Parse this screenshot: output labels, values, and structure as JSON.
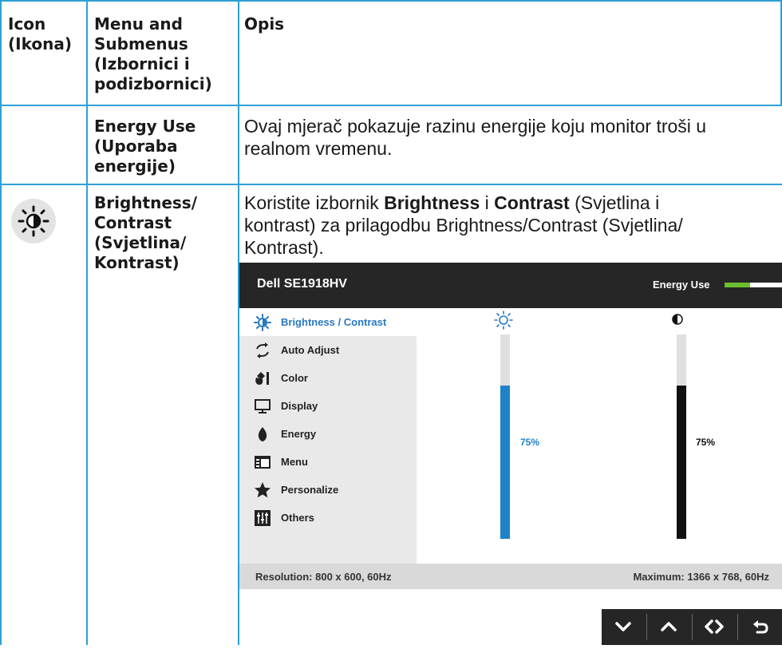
{
  "table": {
    "headers": {
      "icon": [
        "Icon",
        "(Ikona)"
      ],
      "menu": [
        "Menu and",
        "Submenus",
        "(Izbornici i",
        "podizbornici)"
      ],
      "desc": "Opis"
    },
    "rows": [
      {
        "icon": "",
        "menu": [
          "Energy Use",
          "(Uporaba",
          "energije)"
        ],
        "desc_lines": [
          "Ovaj mjerač pokazuje razinu energije koju monitor troši u",
          "realnom vremenu."
        ]
      },
      {
        "icon": "sun-brightness-icon",
        "menu": [
          "Brightness/",
          "Contrast",
          "(Svjetlina/",
          "Kontrast)"
        ],
        "desc": {
          "p1": "Koristite izbornik ",
          "b1": "Brightness",
          "p2": " i ",
          "b2": "Contrast",
          "p3": " (Svjetlina i",
          "line2": "kontrast) za prilagodbu Brightness/Contrast (Svjetlina/",
          "line3": "Kontrast)."
        }
      }
    ]
  },
  "osd": {
    "title": "Dell SE1918HV",
    "energy_label": "Energy Use",
    "energy_level": 0.45,
    "menu": [
      {
        "label": "Brightness / Contrast",
        "icon": "brightness-icon",
        "active": true
      },
      {
        "label": "Auto Adjust",
        "icon": "auto-adjust-icon",
        "active": false
      },
      {
        "label": "Color",
        "icon": "color-icon",
        "active": false
      },
      {
        "label": "Display",
        "icon": "display-icon",
        "active": false
      },
      {
        "label": "Energy",
        "icon": "energy-icon",
        "active": false
      },
      {
        "label": "Menu",
        "icon": "menu-icon",
        "active": false
      },
      {
        "label": "Personalize",
        "icon": "star-icon",
        "active": false
      },
      {
        "label": "Others",
        "icon": "others-icon",
        "active": false
      }
    ],
    "brightness": {
      "value": 75,
      "label": "75%",
      "color": "#1e82c8"
    },
    "contrast": {
      "value": 75,
      "label": "75%",
      "color": "#111111"
    },
    "footer": {
      "left": "Resolution: 800 x 600, 60Hz",
      "right": "Maximum: 1366 x 768, 60Hz"
    },
    "nav_buttons": [
      "down-arrow-icon",
      "up-arrow-icon",
      "left-right-arrows-icon",
      "back-icon"
    ]
  }
}
